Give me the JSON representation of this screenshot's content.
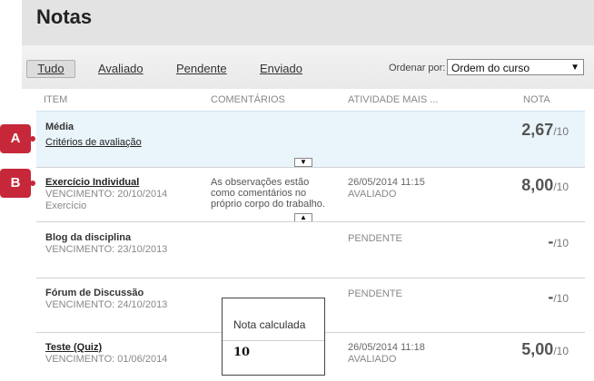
{
  "header": {
    "title": "Notas"
  },
  "tabs": [
    {
      "label": "Tudo"
    },
    {
      "label": "Avaliado"
    },
    {
      "label": "Pendente"
    },
    {
      "label": "Enviado"
    }
  ],
  "sort": {
    "label": "Ordenar por:",
    "value": "Ordem do curso"
  },
  "columns": {
    "item": "ITEM",
    "comments": "COMENTÁRIOS",
    "activity": "ATIVIDADE MAIS ...",
    "grade": "NOTA"
  },
  "rows": [
    {
      "title": "Média",
      "link": "Critérios de avaliação",
      "grade": "2,67",
      "total": "/10"
    },
    {
      "title": "Exercício Individual",
      "due": "VENCIMENTO: 20/10/2014",
      "type": "Exercício",
      "comment": "As observações estão como comentários no próprio corpo do trabalho.",
      "activity_date": "26/05/2014 11:15",
      "status": "AVALIADO",
      "grade": "8,00",
      "total": "/10"
    },
    {
      "title": "Blog da disciplina",
      "due": "VENCIMENTO: 23/10/2013",
      "status": "PENDENTE",
      "grade": "-",
      "total": "/10"
    },
    {
      "title": "Fórum de Discussão",
      "due": "VENCIMENTO: 24/10/2013",
      "status": "PENDENTE",
      "grade": "-",
      "total": "/10"
    },
    {
      "title": "Teste (Quiz)",
      "due": "VENCIMENTO: 01/06/2014",
      "activity_date": "26/05/2014 11:18",
      "status": "AVALIADO",
      "grade": "5,00",
      "total": "/10"
    }
  ],
  "markers": [
    "A",
    "B"
  ],
  "popup": {
    "label": "Nota calculada",
    "value": "10"
  },
  "icons": {
    "sort_arrow": "chevron-down-icon",
    "expand": "caret-down-icon",
    "collapse": "caret-up-icon"
  },
  "colors": {
    "marker": "#c6283a",
    "highlight_row": "#e9f4fb",
    "header_bg": "#e3e3e3"
  }
}
